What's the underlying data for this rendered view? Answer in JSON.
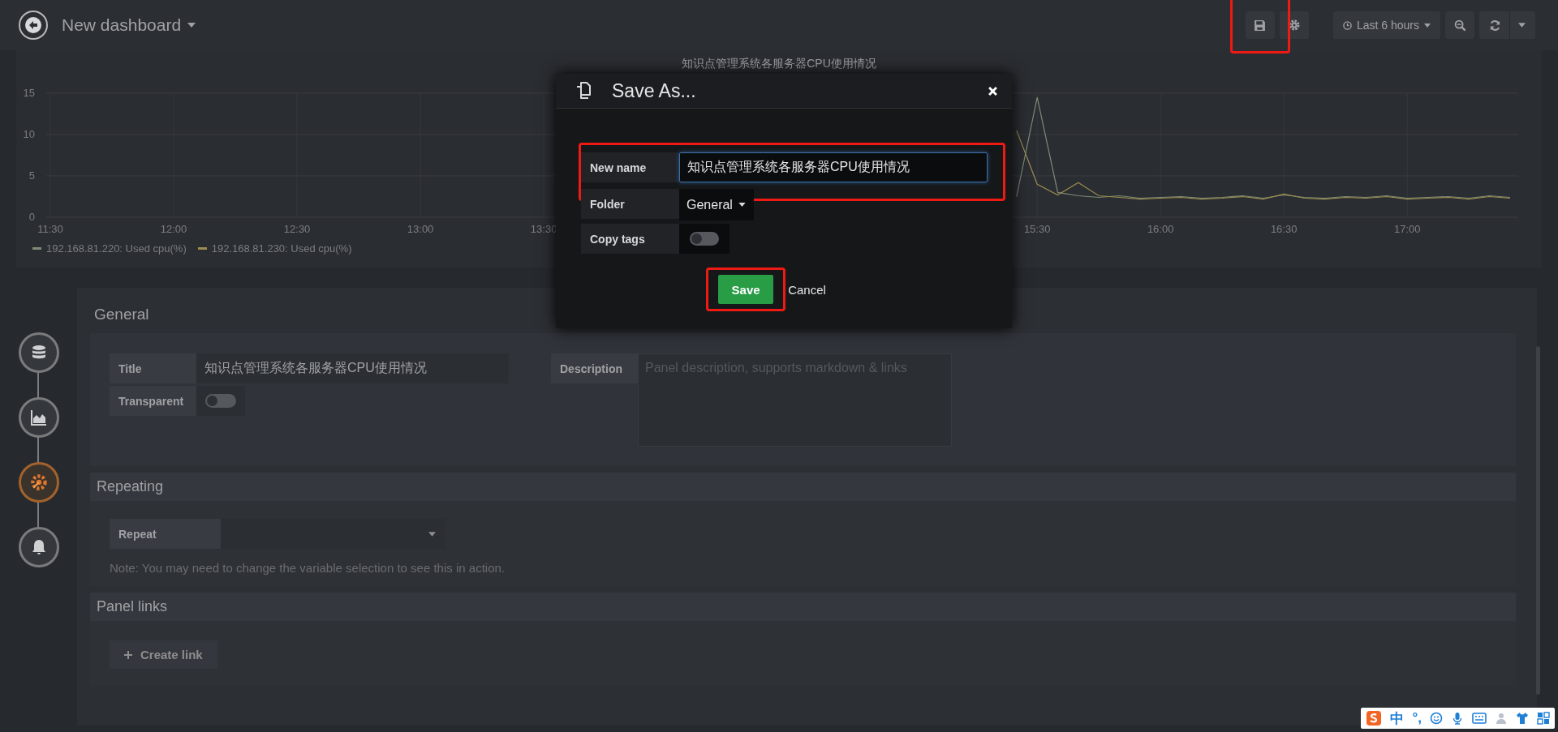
{
  "top_bar": {
    "title": "New dashboard",
    "time_picker": "Last 6 hours"
  },
  "graph_panel": {
    "title": "知识点管理系统各服务器CPU使用情况",
    "chart_data": {
      "type": "line",
      "grid": true,
      "ylim": [
        0,
        15
      ],
      "yticks": [
        0,
        5,
        10,
        15
      ],
      "categories": [
        "11:30",
        null,
        null,
        null,
        null,
        null,
        "12:00",
        null,
        null,
        null,
        null,
        null,
        "12:30",
        null,
        null,
        null,
        null,
        null,
        "13:00",
        null,
        null,
        null,
        null,
        null,
        "13:30",
        null,
        null,
        null,
        null,
        null,
        null,
        null,
        null,
        null,
        null,
        null,
        null,
        null,
        null,
        null,
        null,
        null,
        null,
        null,
        null,
        null,
        null,
        null,
        "15:30",
        null,
        null,
        null,
        null,
        null,
        "16:00",
        null,
        null,
        null,
        null,
        null,
        "16:30",
        null,
        null,
        null,
        null,
        null,
        "17:00",
        null,
        null,
        null,
        null,
        null
      ],
      "series": [
        {
          "name": "192.168.81.220: Used cpu(%)",
          "color": "#7d8c74",
          "values": [
            null,
            null,
            null,
            null,
            null,
            null,
            null,
            null,
            null,
            null,
            null,
            null,
            null,
            null,
            null,
            null,
            null,
            null,
            null,
            null,
            null,
            null,
            null,
            null,
            null,
            null,
            null,
            null,
            null,
            null,
            null,
            null,
            null,
            null,
            null,
            null,
            null,
            null,
            null,
            null,
            null,
            null,
            null,
            null,
            null,
            null,
            null,
            2.5,
            14.5,
            3,
            2.6,
            2.4,
            2.6,
            2.3,
            2.4,
            2.5,
            2.3,
            2.4,
            2.6,
            2.3,
            2.7,
            2.4,
            2.3,
            2.5,
            2.4,
            2.6,
            2.3,
            2.4,
            2.5,
            2.3,
            2.6,
            2.4
          ]
        },
        {
          "name": "192.168.81.230: Used cpu(%)",
          "color": "#9c8d4f",
          "values": [
            null,
            null,
            null,
            null,
            null,
            null,
            null,
            null,
            null,
            null,
            null,
            null,
            null,
            null,
            null,
            null,
            null,
            null,
            null,
            null,
            null,
            null,
            null,
            null,
            null,
            null,
            null,
            null,
            null,
            null,
            null,
            null,
            null,
            null,
            null,
            null,
            null,
            null,
            null,
            null,
            null,
            null,
            null,
            null,
            null,
            null,
            null,
            10.5,
            4,
            2.7,
            4.2,
            2.6,
            2.4,
            2.2,
            2.3,
            2.4,
            2.2,
            2.3,
            2.5,
            2.2,
            2.8,
            2.3,
            2.2,
            2.4,
            2.3,
            2.5,
            2.2,
            2.3,
            2.4,
            2.2,
            2.5,
            2.3
          ]
        }
      ]
    }
  },
  "editor_steps": [
    {
      "kind": "queries",
      "selected": false
    },
    {
      "kind": "visualization",
      "selected": false
    },
    {
      "kind": "general",
      "selected": true
    },
    {
      "kind": "alert",
      "selected": false
    }
  ],
  "general": {
    "heading": "General",
    "title_label": "Title",
    "title_value": "知识点管理系统各服务器CPU使用情况",
    "transparent_label": "Transparent",
    "transparent_checked": false,
    "description_label": "Description",
    "description_placeholder": "Panel description, supports markdown & links"
  },
  "repeating": {
    "heading": "Repeating",
    "repeat_label": "Repeat",
    "note": "Note: You may need to change the variable selection to see this in action."
  },
  "panel_links": {
    "heading": "Panel links",
    "create_button": "Create link"
  },
  "dialog": {
    "title": "Save As...",
    "fields": [
      {
        "kind": "text",
        "label": "New name",
        "value": "知识点管理系统各服务器CPU使用情况"
      },
      {
        "kind": "select",
        "label": "Folder",
        "value": "General"
      },
      {
        "kind": "toggle",
        "label": "Copy tags",
        "checked": false
      }
    ],
    "save_button": "Save",
    "cancel_link": "Cancel"
  },
  "ime_bar": {
    "mode": "中",
    "punctuation": "°,"
  }
}
